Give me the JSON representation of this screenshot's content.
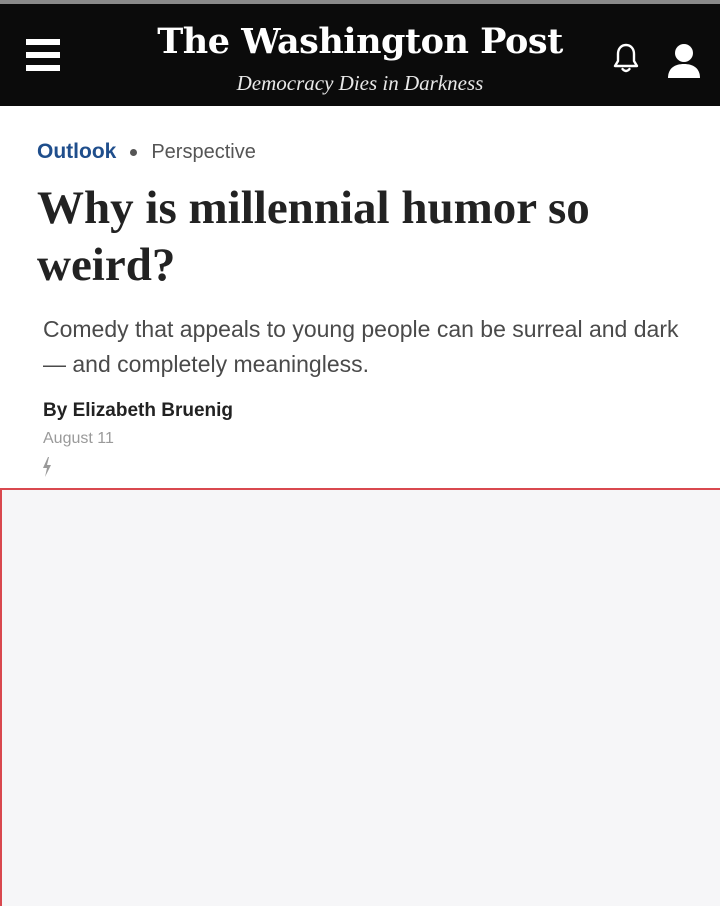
{
  "masthead": {
    "title": "The Washington Post",
    "tagline": "Democracy Dies in Darkness",
    "menu_icon": "hamburger-menu-icon",
    "notification_icon": "bell-icon",
    "account_icon": "user-icon"
  },
  "article": {
    "section": "Outlook",
    "label": "Perspective",
    "headline": "Why is millennial humor so weird?",
    "subhead": "Comedy that appeals to young people can be surreal and dark — and completely meaningless.",
    "byline_prefix": "By",
    "author": "Elizabeth Bruenig",
    "date": "August 11",
    "flash_icon": "lightning-bolt-icon"
  },
  "colors": {
    "masthead_bg": "#0b0b0b",
    "section_link": "#1f4e8c",
    "frame_border": "#d9484f",
    "frame_bg": "#f6f6f8"
  }
}
